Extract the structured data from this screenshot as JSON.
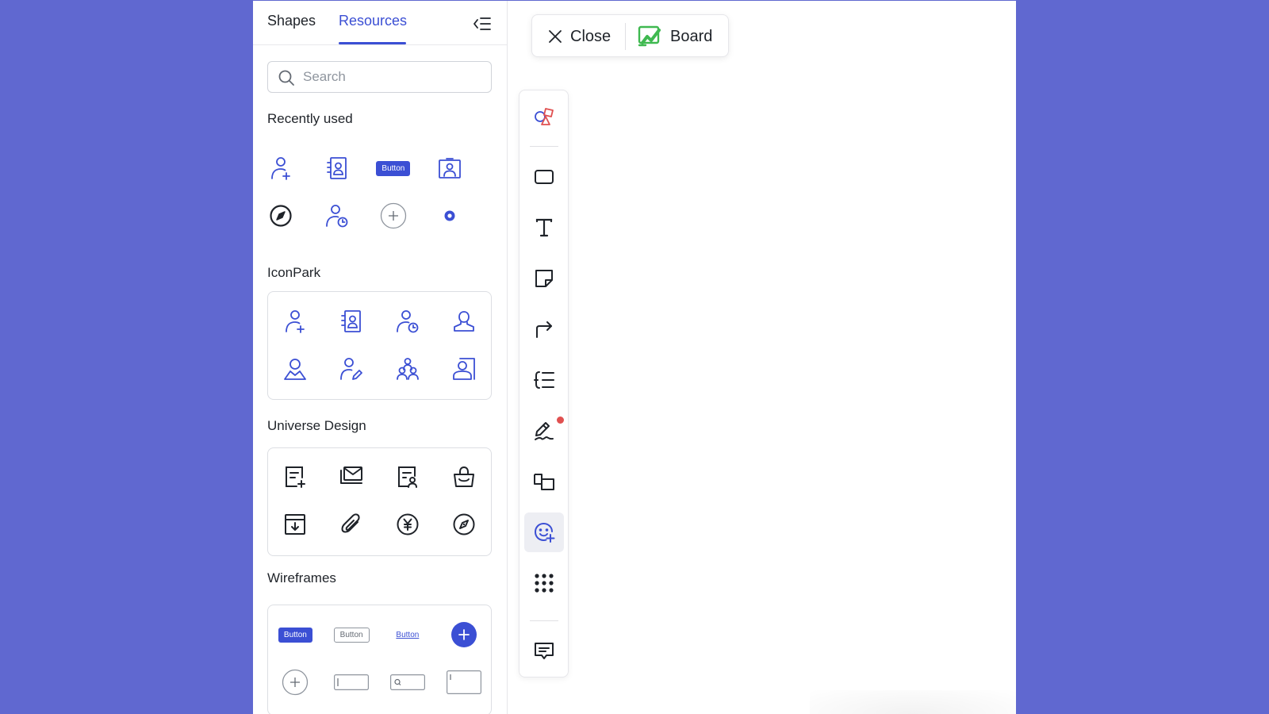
{
  "panel": {
    "tabs": [
      {
        "label": "Shapes"
      },
      {
        "label": "Resources"
      }
    ],
    "search": {
      "placeholder": "Search",
      "value": ""
    },
    "recently_used": {
      "title": "Recently used",
      "items": [
        "user-add-icon",
        "contact-card-icon",
        "button-component",
        "id-badge-icon",
        "compass-icon",
        "user-clock-icon",
        "add-circle-icon",
        "radio-dot-icon"
      ],
      "button_label": "Button"
    },
    "iconpark": {
      "title": "IconPark",
      "items": [
        "user-add-icon",
        "contact-card-icon",
        "user-clock-icon",
        "user-bust-icon",
        "user-avatar-icon",
        "user-edit-icon",
        "team-icon",
        "user-card-icon"
      ]
    },
    "universe_design": {
      "title": "Universe Design",
      "items": [
        "doc-add-icon",
        "mail-box-icon",
        "doc-user-icon",
        "shopping-bag-icon",
        "archive-download-icon",
        "paperclip-icon",
        "yen-coin-icon",
        "compass-icon"
      ]
    },
    "wireframes": {
      "title": "Wireframes",
      "button_fill": "Button",
      "button_outline": "Button",
      "button_link": "Button",
      "items": [
        "button-filled",
        "button-outline",
        "button-link",
        "fab-add",
        "add-circle-outline",
        "text-input",
        "search-input",
        "textarea-input"
      ]
    }
  },
  "topbar": {
    "close_label": "Close",
    "board_label": "Board"
  },
  "toolbar": {
    "tools": [
      "shapes-icon",
      "rectangle-icon",
      "text-icon",
      "sticky-note-icon",
      "connector-icon",
      "mindmap-icon",
      "pen-icon",
      "frame-icon",
      "resources-icon",
      "more-apps-icon",
      "comment-icon"
    ],
    "active": "resources-icon"
  },
  "colors": {
    "background": "#6068d0",
    "accent": "#3b4fd4",
    "board_green": "#3fb950",
    "notification_red": "#e05050"
  }
}
